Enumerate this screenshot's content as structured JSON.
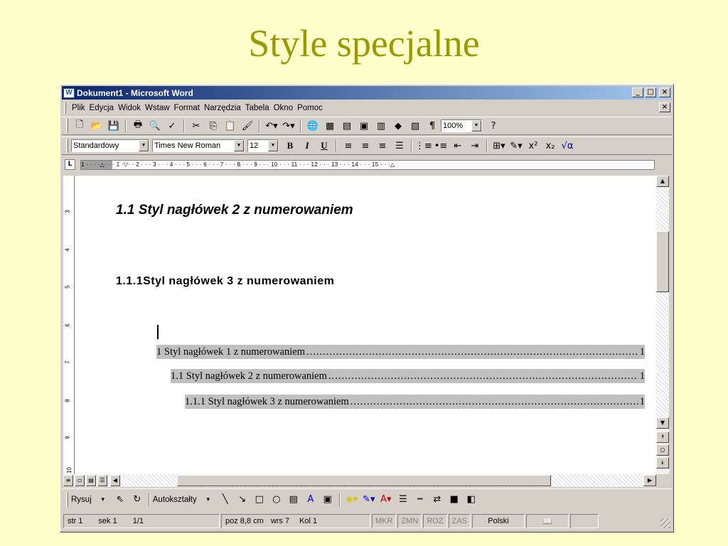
{
  "slide": {
    "title": "Style specjalne"
  },
  "window": {
    "title": "Dokument1 - Microsoft Word",
    "controls": {
      "minimize": "_",
      "maximize": "□",
      "close": "×",
      "doc_close": "×"
    }
  },
  "menu": [
    "Plik",
    "Edycja",
    "Widok",
    "Wstaw",
    "Format",
    "Narzędzia",
    "Tabela",
    "Okno",
    "Pomoc"
  ],
  "toolbar1": {
    "icons": [
      "new-icon",
      "open-icon",
      "save-icon",
      "print-icon",
      "print-preview-icon",
      "spelling-icon",
      "cut-icon",
      "copy-icon",
      "paste-icon",
      "format-painter-icon",
      "undo-icon",
      "redo-icon",
      "hyperlink-icon",
      "tables-borders-icon",
      "insert-table-icon",
      "insert-excel-icon",
      "columns-icon",
      "drawing-icon",
      "document-map-icon",
      "show-formatting-icon",
      "help-icon"
    ],
    "zoom": "100%"
  },
  "toolbar2": {
    "style": "Standardowy",
    "font": "Times New Roman",
    "size": "12",
    "bold": "B",
    "italic": "I",
    "underline": "U",
    "superscript": "x²",
    "subscript": "x₂",
    "equation": "√α"
  },
  "ruler": {
    "tab_marker": "L",
    "text": "1 · · · ·△· · · 1 ·▽· · 2 · · · 3 · · · 4 · · · 5 · · · 6 · · · 7 · · · 8 · · · 9 · · · 10 · · · 11 · · · 12 · · · 13 · · · 14 · · · 15 · · ·△"
  },
  "vruler": [
    "3",
    "4",
    "5",
    "6",
    "7",
    "8",
    "9",
    "10"
  ],
  "document": {
    "heading2": "1.1 Styl nagłówek 2 z numerowaniem",
    "heading3": "1.1.1Styl nagłówek 3 z numerowaniem",
    "toc": [
      {
        "text": "1 Styl nagłówek 1 z numerowaniem",
        "dots": "....................................................................................................................................................",
        "page": "1"
      },
      {
        "text": "1.1 Styl nagłówek 2 z numerowaniem",
        "dots": "....................................................................................................................................................",
        "page": "1"
      },
      {
        "text": "1.1.1 Styl nagłówek 3 z numerowaniem",
        "dots": "....................................................................................................................................................",
        "page": "1"
      }
    ]
  },
  "drawbar": {
    "draw": "Rysuj",
    "autoshapes": "Autokształty"
  },
  "status": {
    "page": "str 1",
    "section": "sek 1",
    "pages": "1/1",
    "position": "poz 8,8 cm",
    "line": "wrs 7",
    "column": "Kol 1",
    "mkr": "MKR",
    "zmn": "ZMN",
    "roz": "ROZ",
    "zas": "ZAS",
    "language": "Polski"
  }
}
